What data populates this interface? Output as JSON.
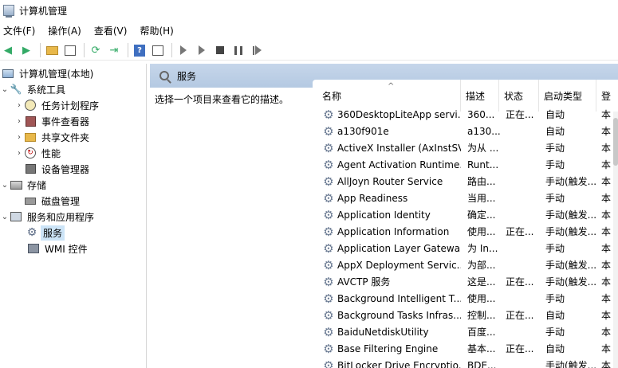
{
  "window": {
    "title": "计算机管理"
  },
  "menu": [
    "文件(F)",
    "操作(A)",
    "查看(V)",
    "帮助(H)"
  ],
  "tree": {
    "root": "计算机管理(本地)",
    "system_tools": "系统工具",
    "task_scheduler": "任务计划程序",
    "event_viewer": "事件查看器",
    "shared_folders": "共享文件夹",
    "performance": "性能",
    "device_manager": "设备管理器",
    "storage": "存储",
    "disk_management": "磁盘管理",
    "services_apps": "服务和应用程序",
    "services": "服务",
    "wmi": "WMI 控件"
  },
  "services_panel": {
    "title": "服务",
    "description_hint": "选择一个项目来查看它的描述。"
  },
  "columns": {
    "name": "名称",
    "desc": "描述",
    "status": "状态",
    "startup": "启动类型",
    "extra": "登"
  },
  "rows": [
    {
      "name": "360DesktopLiteApp servi...",
      "desc": "360...",
      "status": "正在...",
      "startup": "自动",
      "extra": "本"
    },
    {
      "name": "a130f901e",
      "desc": "a130...",
      "status": "",
      "startup": "自动",
      "extra": "本"
    },
    {
      "name": "ActiveX Installer (AxInstSV)",
      "desc": "为从 ...",
      "status": "",
      "startup": "手动",
      "extra": "本"
    },
    {
      "name": "Agent Activation Runtime...",
      "desc": "Runt...",
      "status": "",
      "startup": "手动",
      "extra": "本"
    },
    {
      "name": "AllJoyn Router Service",
      "desc": "路由...",
      "status": "",
      "startup": "手动(触发...",
      "extra": "本"
    },
    {
      "name": "App Readiness",
      "desc": "当用...",
      "status": "",
      "startup": "手动",
      "extra": "本"
    },
    {
      "name": "Application Identity",
      "desc": "确定...",
      "status": "",
      "startup": "手动(触发...",
      "extra": "本"
    },
    {
      "name": "Application Information",
      "desc": "使用...",
      "status": "正在...",
      "startup": "手动(触发...",
      "extra": "本"
    },
    {
      "name": "Application Layer Gatewa...",
      "desc": "为 In...",
      "status": "",
      "startup": "手动",
      "extra": "本"
    },
    {
      "name": "AppX Deployment Servic...",
      "desc": "为部...",
      "status": "",
      "startup": "手动(触发...",
      "extra": "本"
    },
    {
      "name": "AVCTP 服务",
      "desc": "这是...",
      "status": "正在...",
      "startup": "手动(触发...",
      "extra": "本"
    },
    {
      "name": "Background Intelligent T...",
      "desc": "使用...",
      "status": "",
      "startup": "手动",
      "extra": "本"
    },
    {
      "name": "Background Tasks Infras...",
      "desc": "控制...",
      "status": "正在...",
      "startup": "自动",
      "extra": "本"
    },
    {
      "name": "BaiduNetdiskUtility",
      "desc": "百度...",
      "status": "",
      "startup": "手动",
      "extra": "本"
    },
    {
      "name": "Base Filtering Engine",
      "desc": "基本...",
      "status": "正在...",
      "startup": "自动",
      "extra": "本"
    },
    {
      "name": "BitLocker Drive Encryptio...",
      "desc": "BDE...",
      "status": "",
      "startup": "手动(触发...",
      "extra": "本"
    }
  ]
}
